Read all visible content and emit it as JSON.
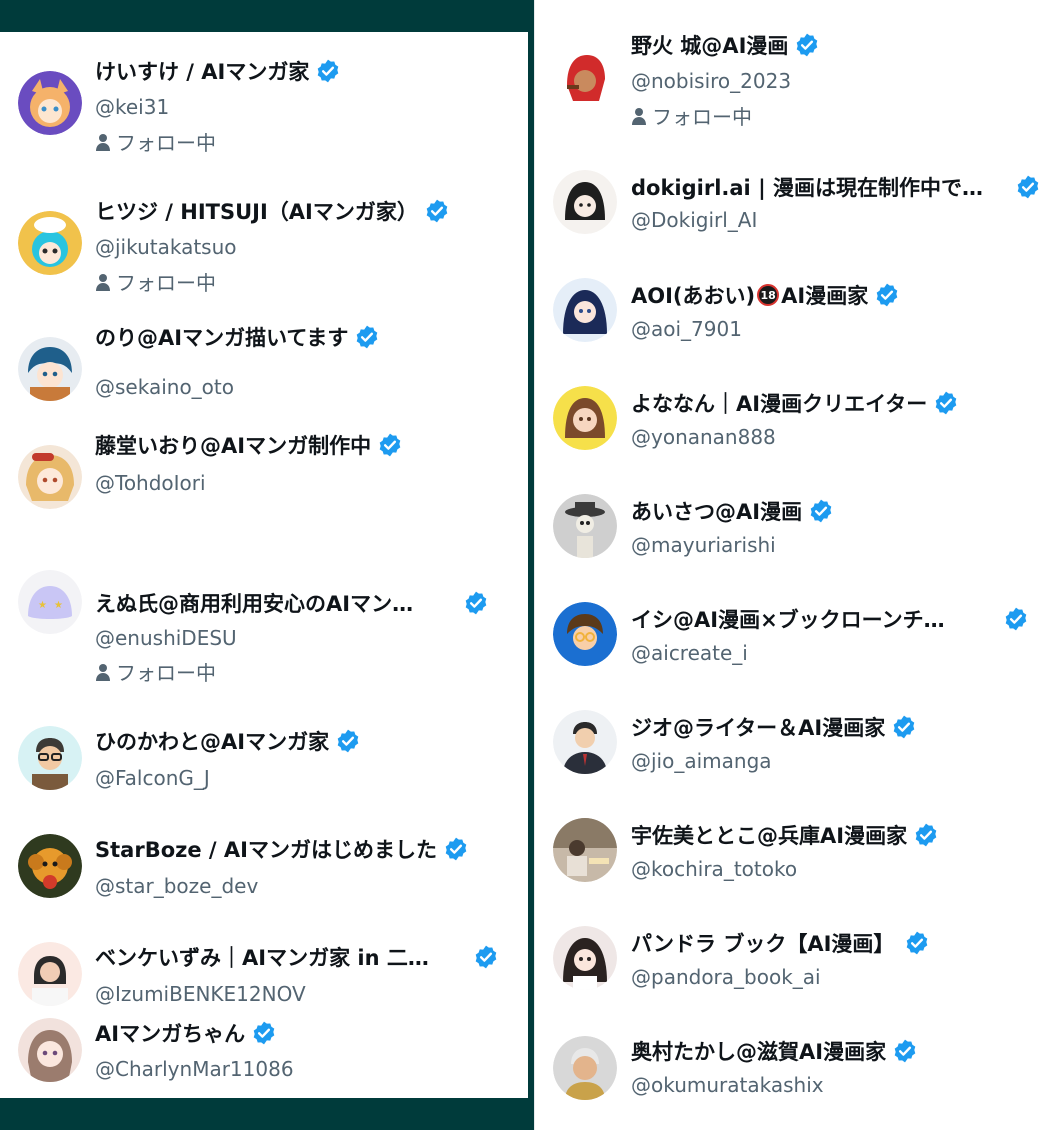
{
  "left_column": [
    {
      "name": "けいすけ / AIマンガ家",
      "handle": "@kei31",
      "following": "フォロー中",
      "avatar": "fox-girl-avatar",
      "avatar_colors": [
        "#6a4cc0",
        "#f5b26a"
      ]
    },
    {
      "name": "ヒツジ / HITSUJI（AIマンガ家）",
      "handle": "@jikutakatsuo",
      "following": "フォロー中",
      "avatar": "sheep-girl-avatar",
      "avatar_colors": [
        "#f1c24b",
        "#29c4e0"
      ]
    },
    {
      "name": "のり@AIマンガ描いてます",
      "handle": "@sekaino_oto",
      "following": "",
      "avatar": "anime-boy-avatar",
      "avatar_colors": [
        "#e7ecf1",
        "#1f5f8b"
      ]
    },
    {
      "name": "藤堂いおり@AIマンガ制作中",
      "handle": "@TohdoIori",
      "following": "",
      "avatar": "blonde-girl-avatar",
      "avatar_colors": [
        "#f4e6d7",
        "#e8b96a"
      ]
    },
    {
      "name": "えぬ氏@商用利用安心のAIマン…",
      "handle": "@enushiDESU",
      "following": "フォロー中",
      "avatar": "slime-avatar",
      "avatar_colors": [
        "#f3f3f6",
        "#c9c6f5"
      ]
    },
    {
      "name": "ひのかわと@AIマンガ家",
      "handle": "@FalconG_J",
      "following": "",
      "avatar": "glasses-man-avatar",
      "avatar_colors": [
        "#d7f2f4",
        "#3d3a36"
      ]
    },
    {
      "name": "StarBoze / AIマンガはじめました",
      "handle": "@star_boze_dev",
      "following": "",
      "avatar": "dog-avatar",
      "avatar_colors": [
        "#2f3a1f",
        "#e79a2c"
      ]
    },
    {
      "name": "ベンケいずみ｜AIマンガ家 in 二…",
      "handle": "@IzumiBENKE12NOV",
      "following": "",
      "avatar": "woman-photo-avatar",
      "avatar_colors": [
        "#fbe9e3",
        "#2b2b2b"
      ]
    },
    {
      "name": "AIマンガちゃん",
      "handle": "@CharlynMar11086",
      "following": "",
      "avatar": "pink-hair-girl-avatar",
      "avatar_colors": [
        "#f2e2dd",
        "#9b7c6e"
      ]
    }
  ],
  "right_column": [
    {
      "name": "野火 城@AI漫画",
      "handle": "@nobisiro_2023",
      "following": "フォロー中",
      "avatar": "red-hood-man-avatar",
      "avatar_colors": [
        "#ffffff",
        "#d12b2b"
      ]
    },
    {
      "name": "dokigirl.ai | 漫画は現在制作中で…",
      "handle": "@Dokigirl_AI",
      "following": "",
      "avatar": "sketch-girl-avatar",
      "avatar_colors": [
        "#f5f2ef",
        "#1e1e1e"
      ]
    },
    {
      "name_parts": [
        "AOI(あおい)",
        "AI漫画家"
      ],
      "no18_label": "18",
      "handle": "@aoi_7901",
      "following": "",
      "avatar": "blue-hair-girl-avatar",
      "avatar_colors": [
        "#e5eef8",
        "#1b2a58"
      ]
    },
    {
      "name": "よななん｜AI漫画クリエイター",
      "handle": "@yonanan888",
      "following": "",
      "avatar": "brown-hair-woman-avatar",
      "avatar_colors": [
        "#f6e04a",
        "#7b4a2b"
      ]
    },
    {
      "name": "あいさつ@AI漫画",
      "handle": "@mayuriarishi",
      "following": "",
      "avatar": "skeleton-avatar",
      "avatar_colors": [
        "#cfcfcf",
        "#3a3a3a"
      ]
    },
    {
      "name": "イシ@AI漫画×ブックローンチ…",
      "handle": "@aicreate_i",
      "following": "",
      "avatar": "glasses-boy-avatar",
      "avatar_colors": [
        "#1b6fd1",
        "#f1b23b"
      ]
    },
    {
      "name": "ジオ@ライター＆AI漫画家",
      "handle": "@jio_aimanga",
      "following": "",
      "avatar": "suit-man-avatar",
      "avatar_colors": [
        "#eef1f4",
        "#2a2f3a"
      ]
    },
    {
      "name": "宇佐美ととこ@兵庫AI漫画家",
      "handle": "@kochira_totoko",
      "following": "",
      "avatar": "cafe-woman-avatar",
      "avatar_colors": [
        "#c7b9a8",
        "#4a3a2e"
      ]
    },
    {
      "name": "パンドラ ブック【AI漫画】",
      "handle": "@pandora_book_ai",
      "following": "",
      "avatar": "dark-hair-girl-avatar",
      "avatar_colors": [
        "#efe7e6",
        "#2a2220"
      ]
    },
    {
      "name": "奥村たかし@滋賀AI漫画家",
      "handle": "@okumuratakashix",
      "following": "",
      "avatar": "old-man-avatar",
      "avatar_colors": [
        "#d8d8d8",
        "#e3b48c"
      ]
    }
  ],
  "icons": {
    "verified": "verified-badge-icon",
    "following": "person-icon"
  },
  "colors": {
    "verified": "#1d9bf0",
    "handle": "#536471",
    "name": "#0f1419",
    "frame": "#003b3b"
  }
}
